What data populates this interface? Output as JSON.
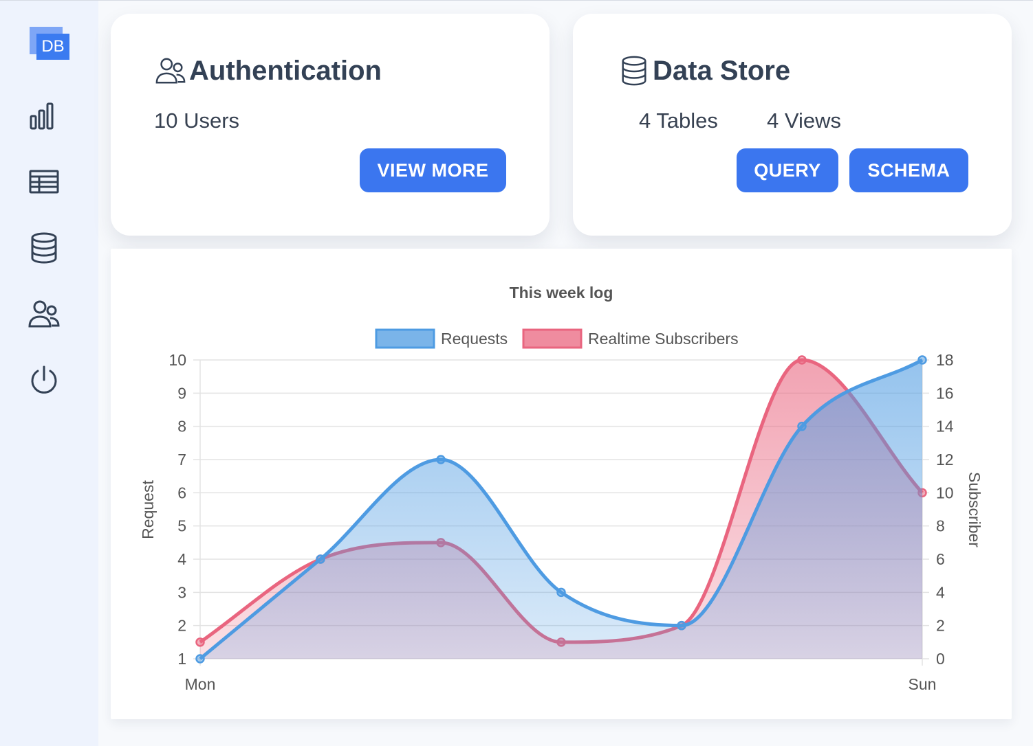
{
  "sidebar": {
    "logo_text": "DB",
    "items": [
      {
        "icon": "bar-chart-icon"
      },
      {
        "icon": "table-icon"
      },
      {
        "icon": "database-icon"
      },
      {
        "icon": "users-icon"
      },
      {
        "icon": "power-icon"
      }
    ]
  },
  "auth_card": {
    "title": "Authentication",
    "icon": "users-icon",
    "users": "10 Users",
    "view_more_label": "VIEW MORE"
  },
  "store_card": {
    "title": "Data Store",
    "icon": "database-icon",
    "tables": "4 Tables",
    "views": "4 Views",
    "query_label": "QUERY",
    "schema_label": "SCHEMA"
  },
  "colors": {
    "primary": "#3b76ef",
    "requests": "#4e9be2",
    "subscribers": "#e9657f",
    "text_dark": "#334155"
  },
  "chart_data": {
    "type": "area",
    "title": "This week log",
    "categories": [
      "Mon",
      "",
      "",
      "",
      "",
      "",
      "Sun"
    ],
    "series": [
      {
        "name": "Requests",
        "axis": "left",
        "values": [
          1,
          4,
          7,
          3,
          2,
          8,
          10
        ]
      },
      {
        "name": "Realtime Subscribers",
        "axis": "right",
        "values": [
          1,
          6,
          7,
          1,
          2,
          18,
          10
        ]
      }
    ],
    "ylabel": "Request",
    "y2label": "Subscriber",
    "ylim": [
      1,
      10
    ],
    "y2lim": [
      0,
      18
    ],
    "yticks": [
      "1",
      "2",
      "3",
      "4",
      "5",
      "6",
      "7",
      "8",
      "9",
      "10"
    ],
    "y2ticks": [
      "0",
      "2",
      "4",
      "6",
      "8",
      "10",
      "12",
      "14",
      "16",
      "18"
    ],
    "grid": true,
    "legend": "top"
  }
}
